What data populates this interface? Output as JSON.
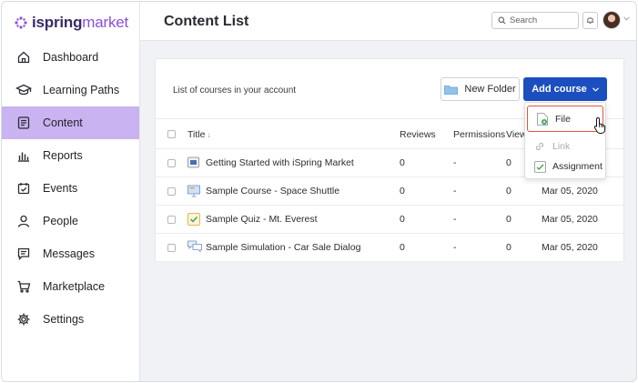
{
  "app": {
    "logo_brand": "ispring",
    "logo_product": "market"
  },
  "sidebar": {
    "items": [
      {
        "label": "Dashboard",
        "icon": "home-icon"
      },
      {
        "label": "Learning Paths",
        "icon": "graduation-cap-icon"
      },
      {
        "label": "Content",
        "icon": "content-icon",
        "active": true
      },
      {
        "label": "Reports",
        "icon": "bar-chart-icon"
      },
      {
        "label": "Events",
        "icon": "calendar-check-icon"
      },
      {
        "label": "People",
        "icon": "person-icon"
      },
      {
        "label": "Messages",
        "icon": "message-icon"
      },
      {
        "label": "Marketplace",
        "icon": "cart-icon"
      },
      {
        "label": "Settings",
        "icon": "gear-icon"
      }
    ]
  },
  "header": {
    "title": "Content List",
    "search_placeholder": "Search"
  },
  "main": {
    "card_title": "List of courses in your account",
    "new_folder_label": "New Folder",
    "add_course_label": "Add course",
    "columns": {
      "title": "Title",
      "reviews": "Reviews",
      "permissions": "Permissions",
      "views": "View"
    },
    "rows": [
      {
        "title": "Getting Started with iSpring Market",
        "reviews": "0",
        "permissions": "-",
        "views": "0",
        "date": "",
        "icon": "video-course-icon"
      },
      {
        "title": "Sample Course - Space Shuttle",
        "reviews": "0",
        "permissions": "-",
        "views": "0",
        "date": "Mar 05, 2020",
        "icon": "presentation-icon"
      },
      {
        "title": "Sample Quiz - Mt. Everest",
        "reviews": "0",
        "permissions": "-",
        "views": "0",
        "date": "Mar 05, 2020",
        "icon": "quiz-icon"
      },
      {
        "title": "Sample Simulation - Car Sale Dialog",
        "reviews": "0",
        "permissions": "-",
        "views": "0",
        "date": "Mar 05, 2020",
        "icon": "dialog-simulation-icon"
      }
    ]
  },
  "dropdown": {
    "items": [
      {
        "label": "File",
        "icon": "file-add-icon"
      },
      {
        "label": "Link",
        "icon": "link-icon",
        "disabled": true
      },
      {
        "label": "Assignment",
        "icon": "assignment-icon"
      }
    ]
  },
  "colors": {
    "accent_blue": "#1b4fbf",
    "sidebar_active": "#c9b3f0",
    "brand_purple": "#8a4fd9",
    "highlight_border": "#e8553b"
  }
}
